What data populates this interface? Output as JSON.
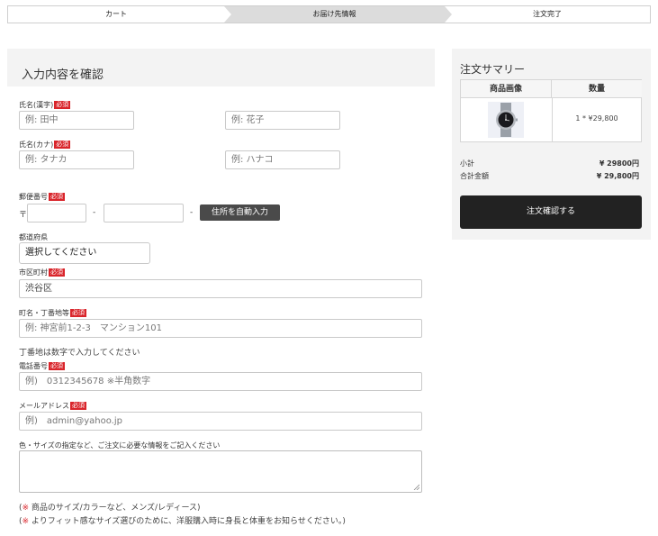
{
  "steps": [
    "カート",
    "お届け先情報",
    "注文完了"
  ],
  "form": {
    "title": "入力内容を確認",
    "required_badge": "必須",
    "name_kanji_label": "氏名(漢字)",
    "name_last_placeholder": "例: 田中",
    "name_first_placeholder": "例: 花子",
    "name_kana_label": "氏名(カナ)",
    "kana_last_placeholder": "例: タナカ",
    "kana_first_placeholder": "例: ハナコ",
    "postal_label": "郵便番号",
    "postal_prefix": "〒",
    "postal_dash1": "-",
    "postal_dash2": "-",
    "auto_address_button": "住所を自動入力",
    "prefecture_label": "都道府県",
    "prefecture_value": "選択してください",
    "city_label": "市区町村",
    "city_value": "渋谷区",
    "street_label": "町名・丁番地等",
    "street_placeholder": "例: 神宮前1-2-3　マンション101",
    "street_hint": "丁番地は数字で入力してください",
    "phone_label": "電話番号",
    "phone_placeholder": "例)　0312345678 ※半角数字",
    "email_label": "メールアドレス",
    "email_placeholder": "例)　admin@yahoo.jp",
    "notes_label": "色・サイズの指定など、ご注文に必要な情報をご記入ください",
    "note_mark": "※",
    "note1_open": "(",
    "note1_text": " 商品のサイズ/カラーなど、メンズ/レディース)",
    "note2_open": "(",
    "note2_text": " よりフィット感なサイズ選びのために、洋服購入時に身長と体重をお知らせください。)"
  },
  "summary": {
    "title": "注文サマリー",
    "col_image": "商品画像",
    "col_qty": "数量",
    "item_qty_price": "1 * ¥29,800",
    "subtotal_label": "小計",
    "subtotal_value": "¥ 29800円",
    "total_label": "合計金額",
    "total_value": "¥ 29,800円",
    "confirm_button": "注文確認する"
  },
  "colors": {
    "accent_red": "#d9252b",
    "dark_button": "#222222",
    "panel_bg": "#f3f3f3"
  },
  "icons": {
    "product_image": "wristwatch-icon"
  }
}
